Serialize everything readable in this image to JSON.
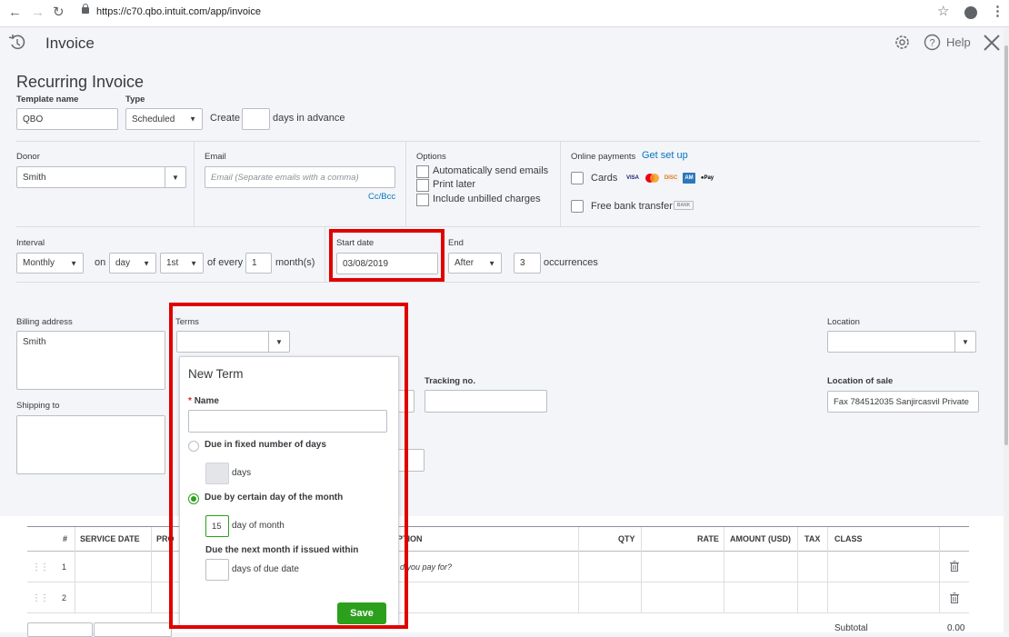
{
  "browser": {
    "url": "https://c70.qbo.intuit.com/app/invoice"
  },
  "header": {
    "title": "Invoice",
    "help_label": "Help"
  },
  "form": {
    "heading": "Recurring Invoice",
    "template_name_label": "Template name",
    "template_name_value": "QBO",
    "type_label": "Type",
    "type_value": "Scheduled",
    "create_label": "Create",
    "create_value": "",
    "days_in_advance": "days in advance",
    "donor_label": "Donor",
    "donor_value": "Smith",
    "email_label": "Email",
    "email_placeholder": "Email (Separate emails with a comma)",
    "cc_bcc": "Cc/Bcc",
    "options_label": "Options",
    "options": [
      "Automatically send emails",
      "Print later",
      "Include unbilled charges"
    ],
    "online_payments_label": "Online payments",
    "get_set_up": "Get set up",
    "cards_label": "Cards",
    "free_bank_label": "Free bank transfer",
    "bank_badge": "BANK",
    "interval_label": "Interval",
    "interval_value": "Monthly",
    "on_label": "on",
    "on_day_value": "day",
    "on_nth_value": "1st",
    "of_every": "of every",
    "every_value": "1",
    "months": "month(s)",
    "start_date_label": "Start date",
    "start_date_value": "03/08/2019",
    "end_label": "End",
    "end_value": "After",
    "occurrences_value": "3",
    "occurrences": "occurrences",
    "billing_address_label": "Billing address",
    "billing_address_value": "Smith",
    "terms_label": "Terms",
    "terms_value": "",
    "shipping_to_label": "Shipping to",
    "tracking_label": "Tracking no.",
    "location_label": "Location",
    "location_value": "",
    "location_of_sale_label": "Location of sale",
    "location_of_sale_value": "Fax 784512035 Sanjircasvil Private"
  },
  "popup": {
    "title": "New Term",
    "required_mark": "*",
    "name_label": "Name",
    "name_value": "",
    "opt_fixed": "Due in fixed number of days",
    "days_value": "",
    "days_label": "days",
    "opt_certain_day": "Due by certain day of the month",
    "day_of_month_value": "15",
    "day_of_month_label": "day of month",
    "next_month_label": "Due the next month if issued within",
    "due_days_value": "",
    "due_days_label": "days of due date",
    "save_label": "Save"
  },
  "table": {
    "headers": [
      "#",
      "SERVICE DATE",
      "PRO",
      "PTION",
      "QTY",
      "RATE",
      "AMOUNT (USD)",
      "TAX",
      "CLASS"
    ],
    "rows": [
      {
        "num": "1",
        "desc_placeholder": "d you pay for?"
      },
      {
        "num": "2",
        "desc_placeholder": ""
      }
    ],
    "subtotal_partial": "Subtotal",
    "subtotal_value_partial": "0.00"
  },
  "colors": {
    "accent_green": "#2ca01c",
    "highlight_red": "#e00000",
    "link_blue": "#0077c5"
  }
}
